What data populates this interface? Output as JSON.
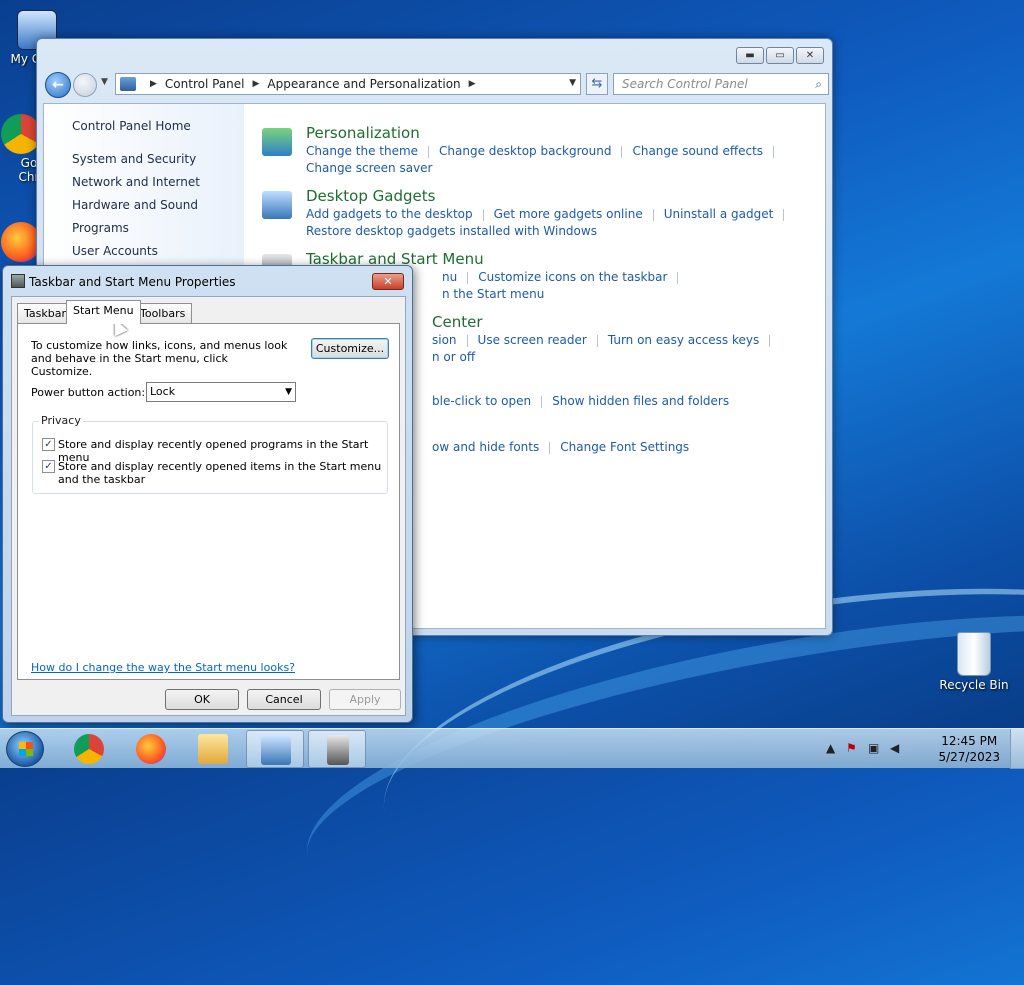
{
  "desktop": {
    "icons": [
      {
        "label": "My Co"
      },
      {
        "label": "Go Chr"
      },
      {
        "label": "Recycle Bin"
      }
    ]
  },
  "control_panel": {
    "breadcrumb": [
      "Control Panel",
      "Appearance and Personalization"
    ],
    "search_placeholder": "Search Control Panel",
    "sidebar": [
      "Control Panel Home",
      "System and Security",
      "Network and Internet",
      "Hardware and Sound",
      "Programs",
      "User Accounts"
    ],
    "categories": [
      {
        "title": "Personalization",
        "links": [
          "Change the theme",
          "Change desktop background",
          "Change sound effects"
        ],
        "links2": [
          "Change screen saver"
        ]
      },
      {
        "title": "Desktop Gadgets",
        "links": [
          "Add gadgets to the desktop",
          "Get more gadgets online",
          "Uninstall a gadget"
        ],
        "links2": [
          "Restore desktop gadgets installed with Windows"
        ]
      },
      {
        "title": "Taskbar and Start Menu",
        "links": [
          "nu",
          "Customize icons on the taskbar"
        ],
        "links2": [
          "n the Start menu"
        ]
      },
      {
        "title": "Center",
        "links": [
          "sion",
          "Use screen reader",
          "Turn on easy access keys"
        ],
        "links2": [
          "n or off"
        ]
      },
      {
        "title": "",
        "links": [
          "ble-click to open",
          "Show hidden files and folders"
        ],
        "links2": []
      },
      {
        "title": "",
        "links": [
          "ow and hide fonts",
          "Change Font Settings"
        ],
        "links2": []
      }
    ]
  },
  "dialog": {
    "title": "Taskbar and Start Menu Properties",
    "tabs": [
      "Taskbar",
      "Start Menu",
      "Toolbars"
    ],
    "active_tab": "Start Menu",
    "description": "To customize how links, icons, and menus look and behave in the Start menu, click Customize.",
    "customize_label": "Customize...",
    "power_label": "Power button action:",
    "power_value": "Lock",
    "privacy_label": "Privacy",
    "checkboxes": [
      {
        "label": "Store and display recently opened programs in the Start menu",
        "checked": true
      },
      {
        "label": "Store and display recently opened items in the Start menu and the taskbar",
        "checked": true
      }
    ],
    "help_link": "How do I change the way the Start menu looks?",
    "ok_label": "OK",
    "cancel_label": "Cancel",
    "apply_label": "Apply"
  },
  "taskbar": {
    "time": "12:45 PM",
    "date": "5/27/2023"
  },
  "colors": {
    "link_blue": "#1e5aa8",
    "category_green": "#1e6e2e",
    "desktop_blue": "#0f5cc0"
  }
}
